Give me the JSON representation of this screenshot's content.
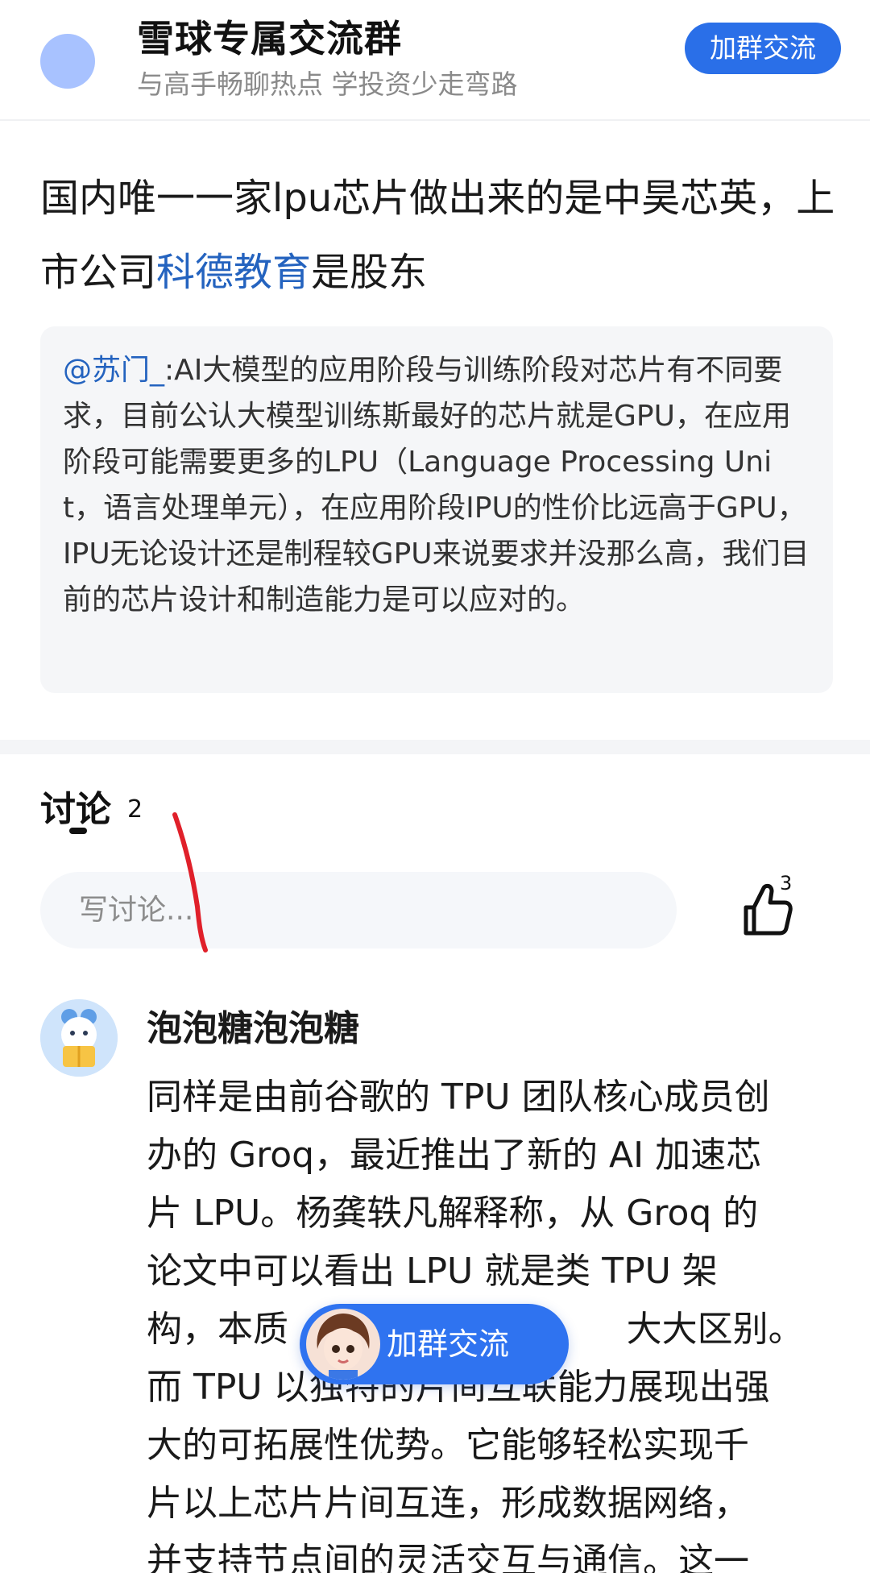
{
  "banner": {
    "title": "雪球专属交流群",
    "subtitle": "与高手畅聊热点 学投资少走弯路",
    "join_label": "加群交流"
  },
  "post": {
    "title_before": "国内唯一一家lpu芯片做出来的是中昊芯英，上市公司",
    "title_link": "科德教育",
    "title_after": "是股东",
    "quote_author": "@苏门_",
    "quote_text": ":AI大模型的应用阶段与训练阶段对芯片有不同要求，目前公认大模型训练斯最好的芯片就是GPU，在应用阶段可能需要更多的LPU（Language Processing Unit，语言处理单元），在应用阶段IPU的性价比远高于GPU，IPU无论设计还是制程较GPU来说要求并没那么高，我们目前的芯片设计和制造能力是可以应对的。"
  },
  "discussion": {
    "tab_label": "讨论",
    "count": "2",
    "input_placeholder": "写讨论...",
    "like_count": "3"
  },
  "comment": {
    "author": "泡泡糖泡泡糖",
    "lines": [
      "同样是由前谷歌的 TPU 团队核心成员创",
      "办的 Groq，最近推出了新的 AI 加速芯",
      "片 LPU。杨龚轶凡解释称，从 Groq 的",
      "论文中可以看出 LPU 就是类 TPU 架",
      "构，本质                              大大区别。",
      "而 TPU 以独特的片间互联能力展现出强",
      "大的可拓展性优势。它能够轻松实现千",
      "片以上芯片片间互连，形成数据网络，",
      "并支持节点间的灵活交互与通信。这一"
    ]
  },
  "floating": {
    "join_label": "加群交流"
  },
  "colors": {
    "accent": "#2a6fe8",
    "link": "#2463bf",
    "annotation": "#e0202a"
  }
}
